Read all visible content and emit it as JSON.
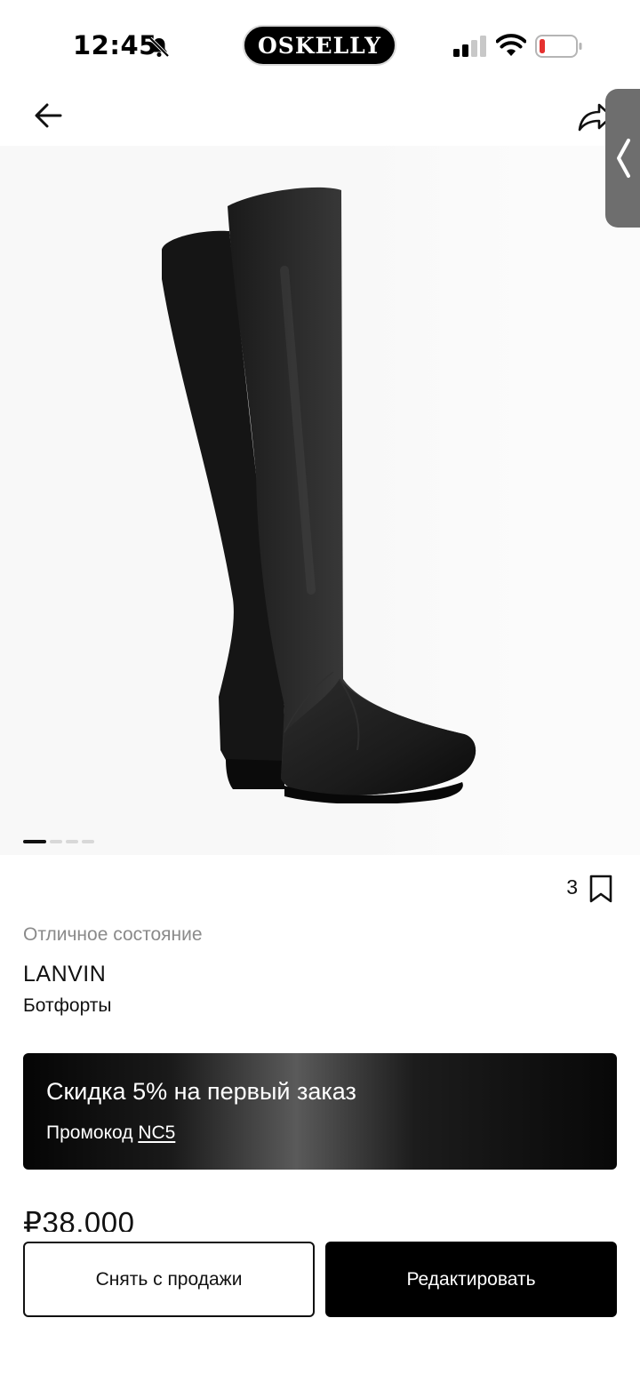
{
  "status_bar": {
    "time": "12:45",
    "app_pill": "OSKELLY"
  },
  "gallery": {
    "image_count": 4,
    "active_index": 0
  },
  "product": {
    "favorites_count": "3",
    "condition": "Отличное состояние",
    "brand": "LANVIN",
    "category": "Ботфорты",
    "price": "₽38,000"
  },
  "promo": {
    "title": "Скидка 5% на первый заказ",
    "code_label": "Промокод",
    "code": "NC5"
  },
  "actions": {
    "remove_label": "Снять с продажи",
    "edit_label": "Редактировать"
  },
  "colors": {
    "accent": "#000000",
    "battery_low": "#e5312f"
  }
}
